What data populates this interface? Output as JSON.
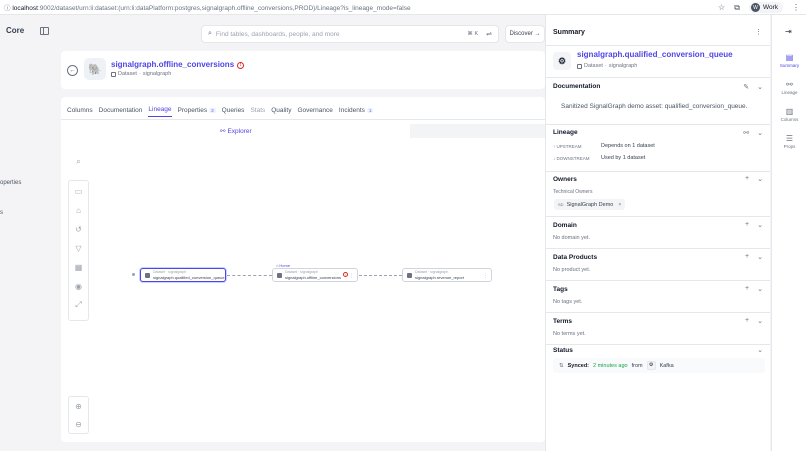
{
  "browser": {
    "url_host": "localhost",
    "url_rest": ":9002/dataset/urn:li:dataset:(urn:li:dataPlatform:postgres,signalgraph.offline_conversions,PROD)/Lineage?is_lineage_mode=false",
    "profile_initial": "W",
    "profile_name": "Work"
  },
  "app": {
    "brand": "Core",
    "search_placeholder": "Find tables, dashboards, people, and more",
    "search_shortcut": "⌘ K",
    "discover_label": "Discover →",
    "left_fragments": [
      "operties",
      "s"
    ]
  },
  "entity": {
    "name": "signalgraph.offline_conversions",
    "type": "Dataset",
    "platform": "signalgraph"
  },
  "tabs": [
    {
      "label": "Columns",
      "state": "normal",
      "count": ""
    },
    {
      "label": "Documentation",
      "state": "normal",
      "count": ""
    },
    {
      "label": "Lineage",
      "state": "active",
      "count": ""
    },
    {
      "label": "Properties",
      "state": "normal",
      "count": "3"
    },
    {
      "label": "Queries",
      "state": "normal",
      "count": ""
    },
    {
      "label": "Stats",
      "state": "muted",
      "count": ""
    },
    {
      "label": "Quality",
      "state": "normal",
      "count": ""
    },
    {
      "label": "Governance",
      "state": "normal",
      "count": ""
    },
    {
      "label": "Incidents",
      "state": "normal",
      "count": "1"
    }
  ],
  "lineage": {
    "explorer_label": "Explorer",
    "home_label": "Home",
    "nodes": [
      {
        "type": "Dataset · signalgraph",
        "name": "signalgraph.qualified_conversion_queue"
      },
      {
        "type": "Dataset · signalgraph",
        "name": "signalgraph.offline_conversions"
      },
      {
        "type": "Dataset · signalgraph",
        "name": "signalgraph.revenue_report"
      }
    ]
  },
  "summary": {
    "title": "Summary",
    "asset_name": "signalgraph.qualified_conversion_queue",
    "asset_type": "Dataset",
    "asset_platform": "signalgraph",
    "documentation_title": "Documentation",
    "documentation_text": "Sanitized SignalGraph demo asset: qualified_conversion_queue.",
    "lineage_title": "Lineage",
    "upstream_label": "UPSTREAM",
    "upstream_value": "Depends on 1 dataset",
    "downstream_label": "DOWNSTREAM",
    "downstream_value": "Used by 1 dataset",
    "owners_title": "Owners",
    "owners_sub": "Technical Owners",
    "owner_initials": "SD",
    "owner_name": "SignalGraph Demo",
    "domain_title": "Domain",
    "domain_empty": "No domain yet.",
    "products_title": "Data Products",
    "products_empty": "No product yet.",
    "tags_title": "Tags",
    "tags_empty": "No tags yet.",
    "terms_title": "Terms",
    "terms_empty": "No terms yet.",
    "status_title": "Status",
    "status_label": "Synced:",
    "status_when": "2 minutes ago",
    "status_from": "from",
    "status_source": "Kafka"
  },
  "rnav": [
    {
      "label": "Summary",
      "icon": "book-icon",
      "active": true
    },
    {
      "label": "Lineage",
      "icon": "lineage-icon",
      "active": false
    },
    {
      "label": "Columns",
      "icon": "columns-icon",
      "active": false
    },
    {
      "label": "Props",
      "icon": "list-icon",
      "active": false
    }
  ]
}
